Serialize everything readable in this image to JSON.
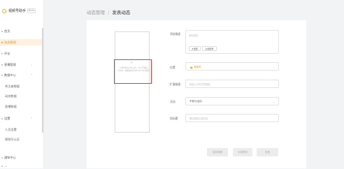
{
  "app": {
    "title": "视频号助手",
    "badge": "Beta"
  },
  "breadcrumb": {
    "parent": "动态管理",
    "separator": "/",
    "current": "发表动态"
  },
  "sidebar": {
    "items": [
      {
        "label": "首页",
        "kind": "top"
      },
      {
        "label": "动态管理",
        "kind": "top",
        "active": true
      },
      {
        "label": "评论",
        "kind": "top"
      },
      {
        "label": "直播管理",
        "kind": "group"
      },
      {
        "label": "数据中心",
        "kind": "group"
      },
      {
        "label": "关注者数据",
        "kind": "sub"
      },
      {
        "label": "动态数据",
        "kind": "sub"
      },
      {
        "label": "直播数据",
        "kind": "sub"
      },
      {
        "label": "设置",
        "kind": "group"
      },
      {
        "label": "人员设置",
        "kind": "sub"
      },
      {
        "label": "视频号认证",
        "kind": "sub"
      },
      {
        "label": "通知中心",
        "kind": "top"
      },
      {
        "label": "...",
        "kind": "top"
      }
    ]
  },
  "upload": {
    "icon": "+",
    "hint": "上传时长8小时以内，大小不超过20GB，视频格式为MP4/H.264格式"
  },
  "form": {
    "description": {
      "label": "添加描述",
      "placeholder": "添加描述",
      "tags": [
        "#话题",
        "@视频号"
      ]
    },
    "location": {
      "label": "位置",
      "value": "深圳市"
    },
    "link": {
      "label": "扩展链接",
      "placeholder": "粘贴公众号文章链接"
    },
    "activity": {
      "label": "活动",
      "value": "不参与活动"
    },
    "short_title": {
      "label": "短标题",
      "placeholder": "概括视频主要内容"
    }
  },
  "buttons": {
    "save_draft": "保存草稿",
    "preview": "手机预览",
    "publish": "发表"
  },
  "colors": {
    "accent": "#f08b1d",
    "highlight": "#e53935"
  }
}
